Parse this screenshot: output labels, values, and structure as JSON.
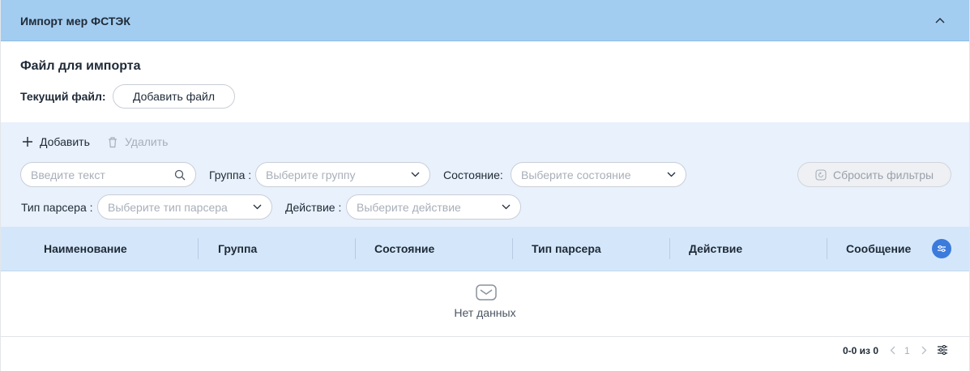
{
  "panel": {
    "title": "Импорт мер ФСТЭК"
  },
  "import": {
    "section_title": "Файл для импорта",
    "current_file_label": "Текущий файл:",
    "add_file_label": "Добавить файл"
  },
  "toolbar": {
    "add_label": "Добавить",
    "delete_label": "Удалить"
  },
  "filters": {
    "search_placeholder": "Введите текст",
    "group_label": "Группа",
    "group_placeholder": "Выберите группу",
    "state_label": "Состояние",
    "state_placeholder": "Выберите состояние",
    "parser_label": "Тип парсера",
    "parser_placeholder": "Выберите тип парсера",
    "action_label": "Действие",
    "action_placeholder": "Выберите действие",
    "reset_label": "Сбросить фильтры",
    "colon": ":"
  },
  "table": {
    "columns": [
      "Наименование",
      "Группа",
      "Состояние",
      "Тип парсера",
      "Действие",
      "Сообщение"
    ],
    "empty_text": "Нет данных"
  },
  "pagination": {
    "info": "0-0 из 0",
    "page": "1"
  },
  "colors": {
    "header_bg": "#a3cdf0",
    "filter_bg": "#e8f1fc",
    "table_header_bg": "#d4e7fa",
    "accent": "#3b7bdc"
  }
}
